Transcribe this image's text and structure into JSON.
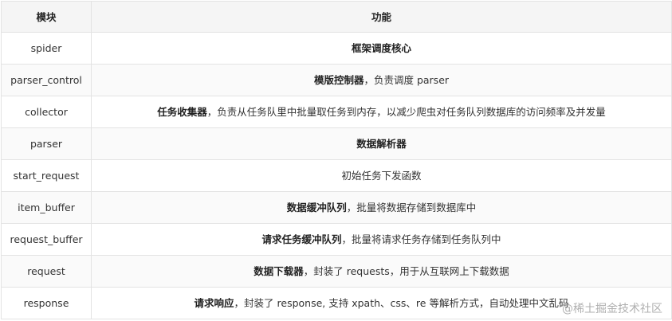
{
  "table": {
    "headers": [
      "模块",
      "功能"
    ],
    "rows": [
      {
        "module": "spider",
        "bold": "框架调度核心",
        "rest": ""
      },
      {
        "module": "parser_control",
        "bold": "模版控制器",
        "rest": "，负责调度 parser"
      },
      {
        "module": "collector",
        "bold": "任务收集器",
        "rest": "，负责从任务队里中批量取任务到内存，以减少爬虫对任务队列数据库的访问频率及并发量"
      },
      {
        "module": "parser",
        "bold": "数据解析器",
        "rest": ""
      },
      {
        "module": "start_request",
        "bold": "",
        "rest": "初始任务下发函数"
      },
      {
        "module": "item_buffer",
        "bold": "数据缓冲队列",
        "rest": "，批量将数据存储到数据库中"
      },
      {
        "module": "request_buffer",
        "bold": "请求任务缓冲队列",
        "rest": "，批量将请求任务存储到任务队列中"
      },
      {
        "module": "request",
        "bold": "数据下载器",
        "rest": "，封装了 requests，用于从互联网上下载数据"
      },
      {
        "module": "response",
        "bold": "请求响应",
        "rest": "，封装了 response, 支持 xpath、css、re 等解析方式，自动处理中文乱码"
      }
    ]
  },
  "watermark": "@稀土掘金技术社区"
}
